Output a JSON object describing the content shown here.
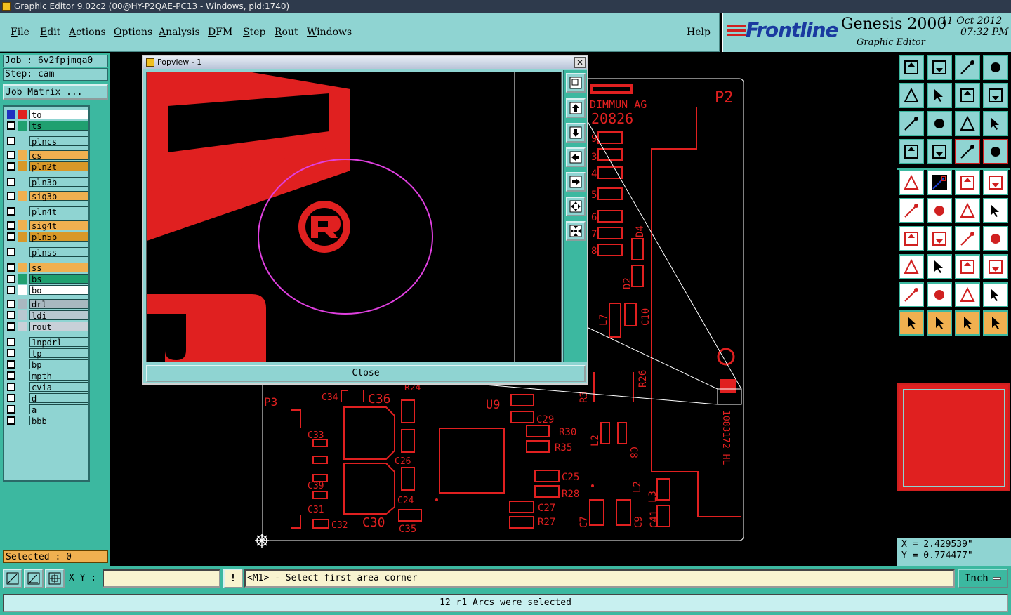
{
  "window": {
    "title": "Graphic Editor 9.02c2 (00@HY-P2QAE-PC13 - Windows, pid:1740)"
  },
  "menu": {
    "items": [
      {
        "first": "F",
        "rest": "ile"
      },
      {
        "first": "E",
        "rest": "dit"
      },
      {
        "first": "A",
        "rest": "ctions"
      },
      {
        "first": "O",
        "rest": "ptions"
      },
      {
        "first": "A",
        "rest": "nalysis"
      },
      {
        "first": "D",
        "rest": "FM"
      },
      {
        "first": "S",
        "rest": "tep"
      },
      {
        "first": "R",
        "rest": "out"
      },
      {
        "first": "W",
        "rest": "indows"
      }
    ],
    "help": "Help"
  },
  "brand": {
    "logo": "Frontline",
    "product": "Genesis 2000",
    "date": "11 Oct 2012",
    "time": "07:32 PM",
    "subtitle": "Graphic Editor"
  },
  "job": {
    "job_label": "Job : 6v2fpjmqa0",
    "step_label": "Step: cam",
    "matrix_button": "Job Matrix ..."
  },
  "layers": [
    {
      "name": "to",
      "color": "#ffffff",
      "swatch": "#e02020",
      "active": true
    },
    {
      "name": "ts",
      "color": "#20a070",
      "swatch": "#20a070",
      "active": false
    },
    {
      "name": "plncs",
      "color": "#8fd4d2",
      "swatch": "#8fd4d2",
      "active": false
    },
    {
      "name": "cs",
      "color": "#f0b050",
      "swatch": "#f0b050",
      "active": false
    },
    {
      "name": "pln2t",
      "color": "#d89828",
      "swatch": "#d89828",
      "active": false
    },
    {
      "name": "pln3b",
      "color": "#8fd4d2",
      "swatch": "#8fd4d2",
      "active": false
    },
    {
      "name": "sig3b",
      "color": "#f0b050",
      "swatch": "#f0b050",
      "active": false
    },
    {
      "name": "pln4t",
      "color": "#8fd4d2",
      "swatch": "#8fd4d2",
      "active": false
    },
    {
      "name": "sig4t",
      "color": "#f0b050",
      "swatch": "#f0b050",
      "active": false
    },
    {
      "name": "pln5b",
      "color": "#d89828",
      "swatch": "#d89828",
      "active": false
    },
    {
      "name": "plnss",
      "color": "#8fd4d2",
      "swatch": "#8fd4d2",
      "active": false
    },
    {
      "name": "ss",
      "color": "#f0b050",
      "swatch": "#f0b050",
      "active": false
    },
    {
      "name": "bs",
      "color": "#20a070",
      "swatch": "#20a070",
      "active": false
    },
    {
      "name": "bo",
      "color": "#ffffff",
      "swatch": "#ffffff",
      "active": false
    },
    {
      "name": "drl",
      "color": "#a8b8c0",
      "swatch": "#a8b8c0",
      "active": false
    },
    {
      "name": "ldi",
      "color": "#b8c8d0",
      "swatch": "#b8c8d0",
      "active": false
    },
    {
      "name": "rout",
      "color": "#c8d0d8",
      "swatch": "#c8d0d8",
      "active": false
    },
    {
      "name": "1npdrl",
      "color": "#8fd4d2",
      "swatch": "#8fd4d2",
      "active": false
    },
    {
      "name": "tp",
      "color": "#8fd4d2",
      "swatch": "#8fd4d2",
      "active": false
    },
    {
      "name": "bp",
      "color": "#8fd4d2",
      "swatch": "#8fd4d2",
      "active": false
    },
    {
      "name": "mpth",
      "color": "#8fd4d2",
      "swatch": "#8fd4d2",
      "active": false
    },
    {
      "name": "cvia",
      "color": "#8fd4d2",
      "swatch": "#8fd4d2",
      "active": false
    },
    {
      "name": "d",
      "color": "#8fd4d2",
      "swatch": "#8fd4d2",
      "active": false
    },
    {
      "name": "a",
      "color": "#8fd4d2",
      "swatch": "#8fd4d2",
      "active": false
    },
    {
      "name": "bbb",
      "color": "#8fd4d2",
      "swatch": "#8fd4d2",
      "active": false
    }
  ],
  "selected_label": "Selected : 0",
  "popview": {
    "title": "Popview - 1",
    "close_x": "✕",
    "close_button": "Close"
  },
  "board": {
    "texts": [
      "DIMMUN AG",
      "20826",
      "P2",
      "U9",
      "C36",
      "C34",
      "C33",
      "C39",
      "C31",
      "C32",
      "C30",
      "C35",
      "C26",
      "C24",
      "C29",
      "R30",
      "R35",
      "C25",
      "R28",
      "C27",
      "R27",
      "C7",
      "C9",
      "C41",
      "L3",
      "L2",
      "D2",
      "D4",
      "C10",
      "L7",
      "R26",
      "R3",
      "L2",
      "C8",
      "R24",
      "P3",
      "1083172 HL",
      "3",
      "4",
      "5",
      "6",
      "7",
      "8",
      "9"
    ]
  },
  "coords": {
    "x": "X = 2.429539\"",
    "y": "Y = 0.774477\""
  },
  "bottom": {
    "xy_label": "X Y :",
    "xy_value": "",
    "prompt": "<M1> - Select first area corner",
    "unit": "Inch",
    "status": "12 r1 Arcs were selected"
  },
  "colors": {
    "teal_light": "#8fd4d2",
    "teal_dark": "#3cb8a0",
    "copper_red": "#e02020",
    "magenta_select": "#e040e0"
  }
}
